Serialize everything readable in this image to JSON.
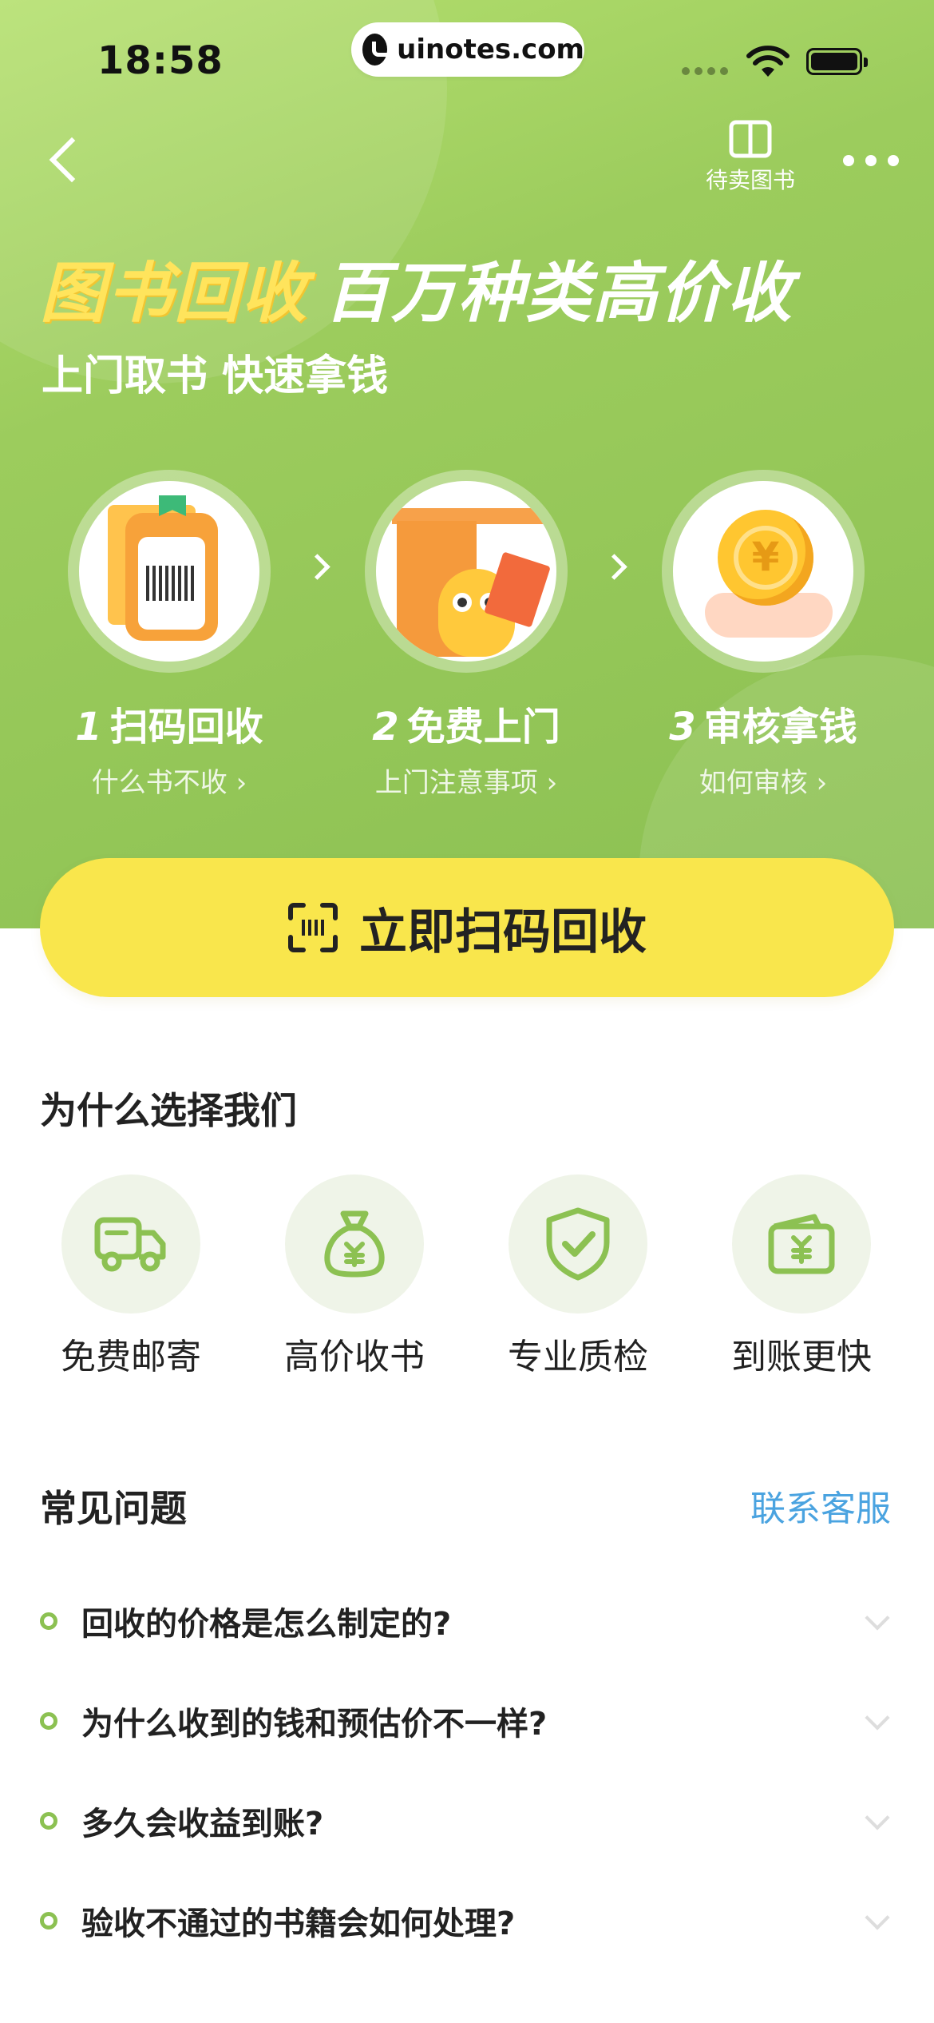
{
  "status_bar": {
    "time": "18:58",
    "url": "uinotes.com"
  },
  "nav": {
    "back_icon": "chevron-left-icon",
    "pending_books_label": "待卖图书",
    "more_icon": "more-dots-icon"
  },
  "hero": {
    "headline_highlight": "图书回收",
    "headline_rest": "百万种类高价收",
    "subline": "上门取书 快速拿钱",
    "steps": [
      {
        "num": "1",
        "title": "扫码回收",
        "link": "什么书不收 ›",
        "icon": "scan-book-illustration"
      },
      {
        "num": "2",
        "title": "免费上门",
        "link": "上门注意事项 ›",
        "icon": "door-delivery-illustration"
      },
      {
        "num": "3",
        "title": "审核拿钱",
        "link": "如何审核 ›",
        "icon": "coin-hand-illustration"
      }
    ]
  },
  "cta": {
    "label": "立即扫码回收",
    "icon": "scan-icon"
  },
  "why": {
    "title": "为什么选择我们",
    "features": [
      {
        "label": "免费邮寄",
        "icon": "truck-icon"
      },
      {
        "label": "高价收书",
        "icon": "money-bag-icon"
      },
      {
        "label": "专业质检",
        "icon": "shield-check-icon"
      },
      {
        "label": "到账更快",
        "icon": "wallet-icon"
      }
    ]
  },
  "faq": {
    "title": "常见问题",
    "contact_label": "联系客服",
    "items": [
      "回收的价格是怎么制定的?",
      "为什么收到的钱和预估价不一样?",
      "多久会收益到账?",
      "验收不通过的书籍会如何处理?"
    ]
  },
  "colors": {
    "hero_green": "#9ccc5d",
    "cta_yellow": "#f9e64c",
    "accent_green": "#8cc152",
    "link_blue": "#4aa3e0"
  }
}
